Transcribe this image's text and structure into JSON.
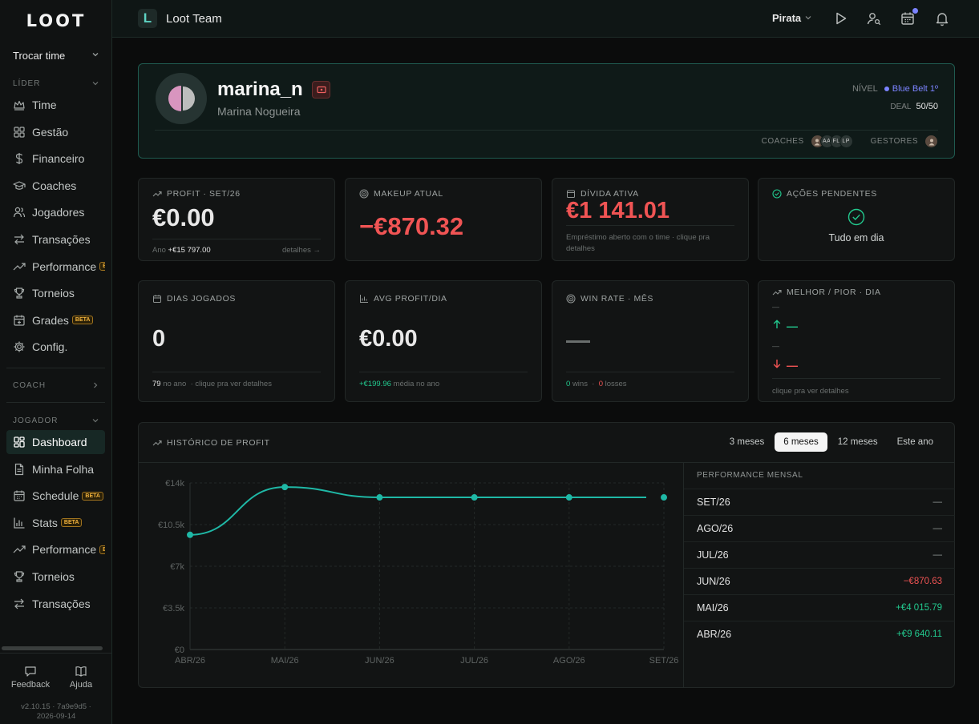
{
  "sidebar": {
    "logo": "LOOT",
    "team_switch": "Trocar time",
    "sections": {
      "lider": "LÍDER",
      "coach": "COACH",
      "jogador": "JOGADOR"
    },
    "lider_items": [
      {
        "label": "Time",
        "icon": "crown-icon"
      },
      {
        "label": "Gestão",
        "icon": "grid-icon"
      },
      {
        "label": "Financeiro",
        "icon": "dollar-icon"
      },
      {
        "label": "Coaches",
        "icon": "graduation-cap-icon"
      },
      {
        "label": "Jogadores",
        "icon": "users-icon"
      },
      {
        "label": "Transações",
        "icon": "arrows-left-right-icon"
      },
      {
        "label": "Performance",
        "icon": "trending-up-icon",
        "badge": "BETA"
      },
      {
        "label": "Torneios",
        "icon": "trophy-icon"
      },
      {
        "label": "Grades",
        "icon": "calendar-plus-icon",
        "badge": "BETA"
      },
      {
        "label": "Config.",
        "icon": "gear-icon"
      }
    ],
    "jogador_items": [
      {
        "label": "Dashboard",
        "icon": "dashboard-icon"
      },
      {
        "label": "Minha Folha",
        "icon": "file-icon"
      },
      {
        "label": "Schedule",
        "icon": "calendar-icon",
        "badge": "BETA"
      },
      {
        "label": "Stats",
        "icon": "bar-chart-icon",
        "badge": "BETA"
      },
      {
        "label": "Performance",
        "icon": "trending-up-icon",
        "badge": "BETA"
      },
      {
        "label": "Torneios",
        "icon": "trophy-icon"
      },
      {
        "label": "Transações",
        "icon": "arrows-left-right-icon"
      }
    ],
    "feedback": "Feedback",
    "ajuda": "Ajuda",
    "version_line1": "v2.10.15 · 7a9e9d5 ·",
    "version_line2": "2026-09-14"
  },
  "topbar": {
    "team_logo_letter": "L",
    "team_name": "Loot Team",
    "user": "Pirata"
  },
  "profile": {
    "username": "marina_n",
    "full_name": "Marina Nogueira",
    "level_label": "NÍVEL",
    "level_value": "Blue Belt 1º",
    "deal_label": "DEAL",
    "deal_value": "50/50",
    "coaches_label": "COACHES",
    "coach_initials": [
      "AA",
      "FL",
      "LP"
    ],
    "gestores_label": "GESTORES"
  },
  "cards": {
    "profit": {
      "title": "PROFIT · SET/26",
      "value": "€0.00",
      "foot_label": "Ano",
      "foot_value": "+€15 797.00",
      "foot_link": "detalhes →"
    },
    "makeup": {
      "title": "MAKEUP ATUAL",
      "value": "−€870.32"
    },
    "divida": {
      "title": "DÍVIDA ATIVA",
      "value": "€1 141.01",
      "foot": "Empréstimo aberto com o time · clique pra detalhes"
    },
    "acoes": {
      "title": "AÇÕES PENDENTES",
      "status": "Tudo em dia"
    },
    "dias": {
      "title": "DIAS JOGADOS",
      "value": "0",
      "foot_value": "79",
      "foot_label": "no ano",
      "foot_link": "· clique pra ver detalhes"
    },
    "avg": {
      "title": "AVG PROFIT/DIA",
      "value": "€0.00",
      "foot_value": "+€199.96",
      "foot_label": "média no ano"
    },
    "winrate": {
      "title": "WIN RATE · MÊS",
      "wins_value": "0",
      "wins_label": "wins",
      "losses_value": "0",
      "losses_label": "losses"
    },
    "melhor": {
      "title": "MELHOR / PIOR · DIA",
      "best_date": "—",
      "best_value": "—",
      "worst_date": "—",
      "worst_value": "—",
      "foot": "clique pra ver detalhes"
    }
  },
  "history": {
    "title": "HISTÓRICO DE PROFIT",
    "ranges": [
      "3 meses",
      "6 meses",
      "12 meses",
      "Este ano"
    ],
    "active_range": 1,
    "perf_title": "PERFORMANCE MENSAL",
    "perf_rows": [
      {
        "month": "SET/26",
        "value": "—",
        "kind": "none"
      },
      {
        "month": "AGO/26",
        "value": "—",
        "kind": "none"
      },
      {
        "month": "JUL/26",
        "value": "—",
        "kind": "none"
      },
      {
        "month": "JUN/26",
        "value": "−€870.63",
        "kind": "neg"
      },
      {
        "month": "MAI/26",
        "value": "+€4 015.79",
        "kind": "pos"
      },
      {
        "month": "ABR/26",
        "value": "+€9 640.11",
        "kind": "pos"
      }
    ]
  },
  "chart_data": {
    "type": "line",
    "x": [
      "ABR/26",
      "MAI/26",
      "JUN/26",
      "JUL/26",
      "AGO/26",
      "SET/26"
    ],
    "series": [
      {
        "values": [
          9640,
          13656,
          12785,
          12785,
          12785,
          12785
        ]
      }
    ],
    "y_ticks": [
      "€0",
      "€3.5k",
      "€7k",
      "€10.5k",
      "€14k"
    ],
    "y_tick_values": [
      0,
      3500,
      7000,
      10500,
      14000
    ],
    "ylim": [
      0,
      14000
    ],
    "grid": true,
    "line_color": "#1fb8a6"
  }
}
